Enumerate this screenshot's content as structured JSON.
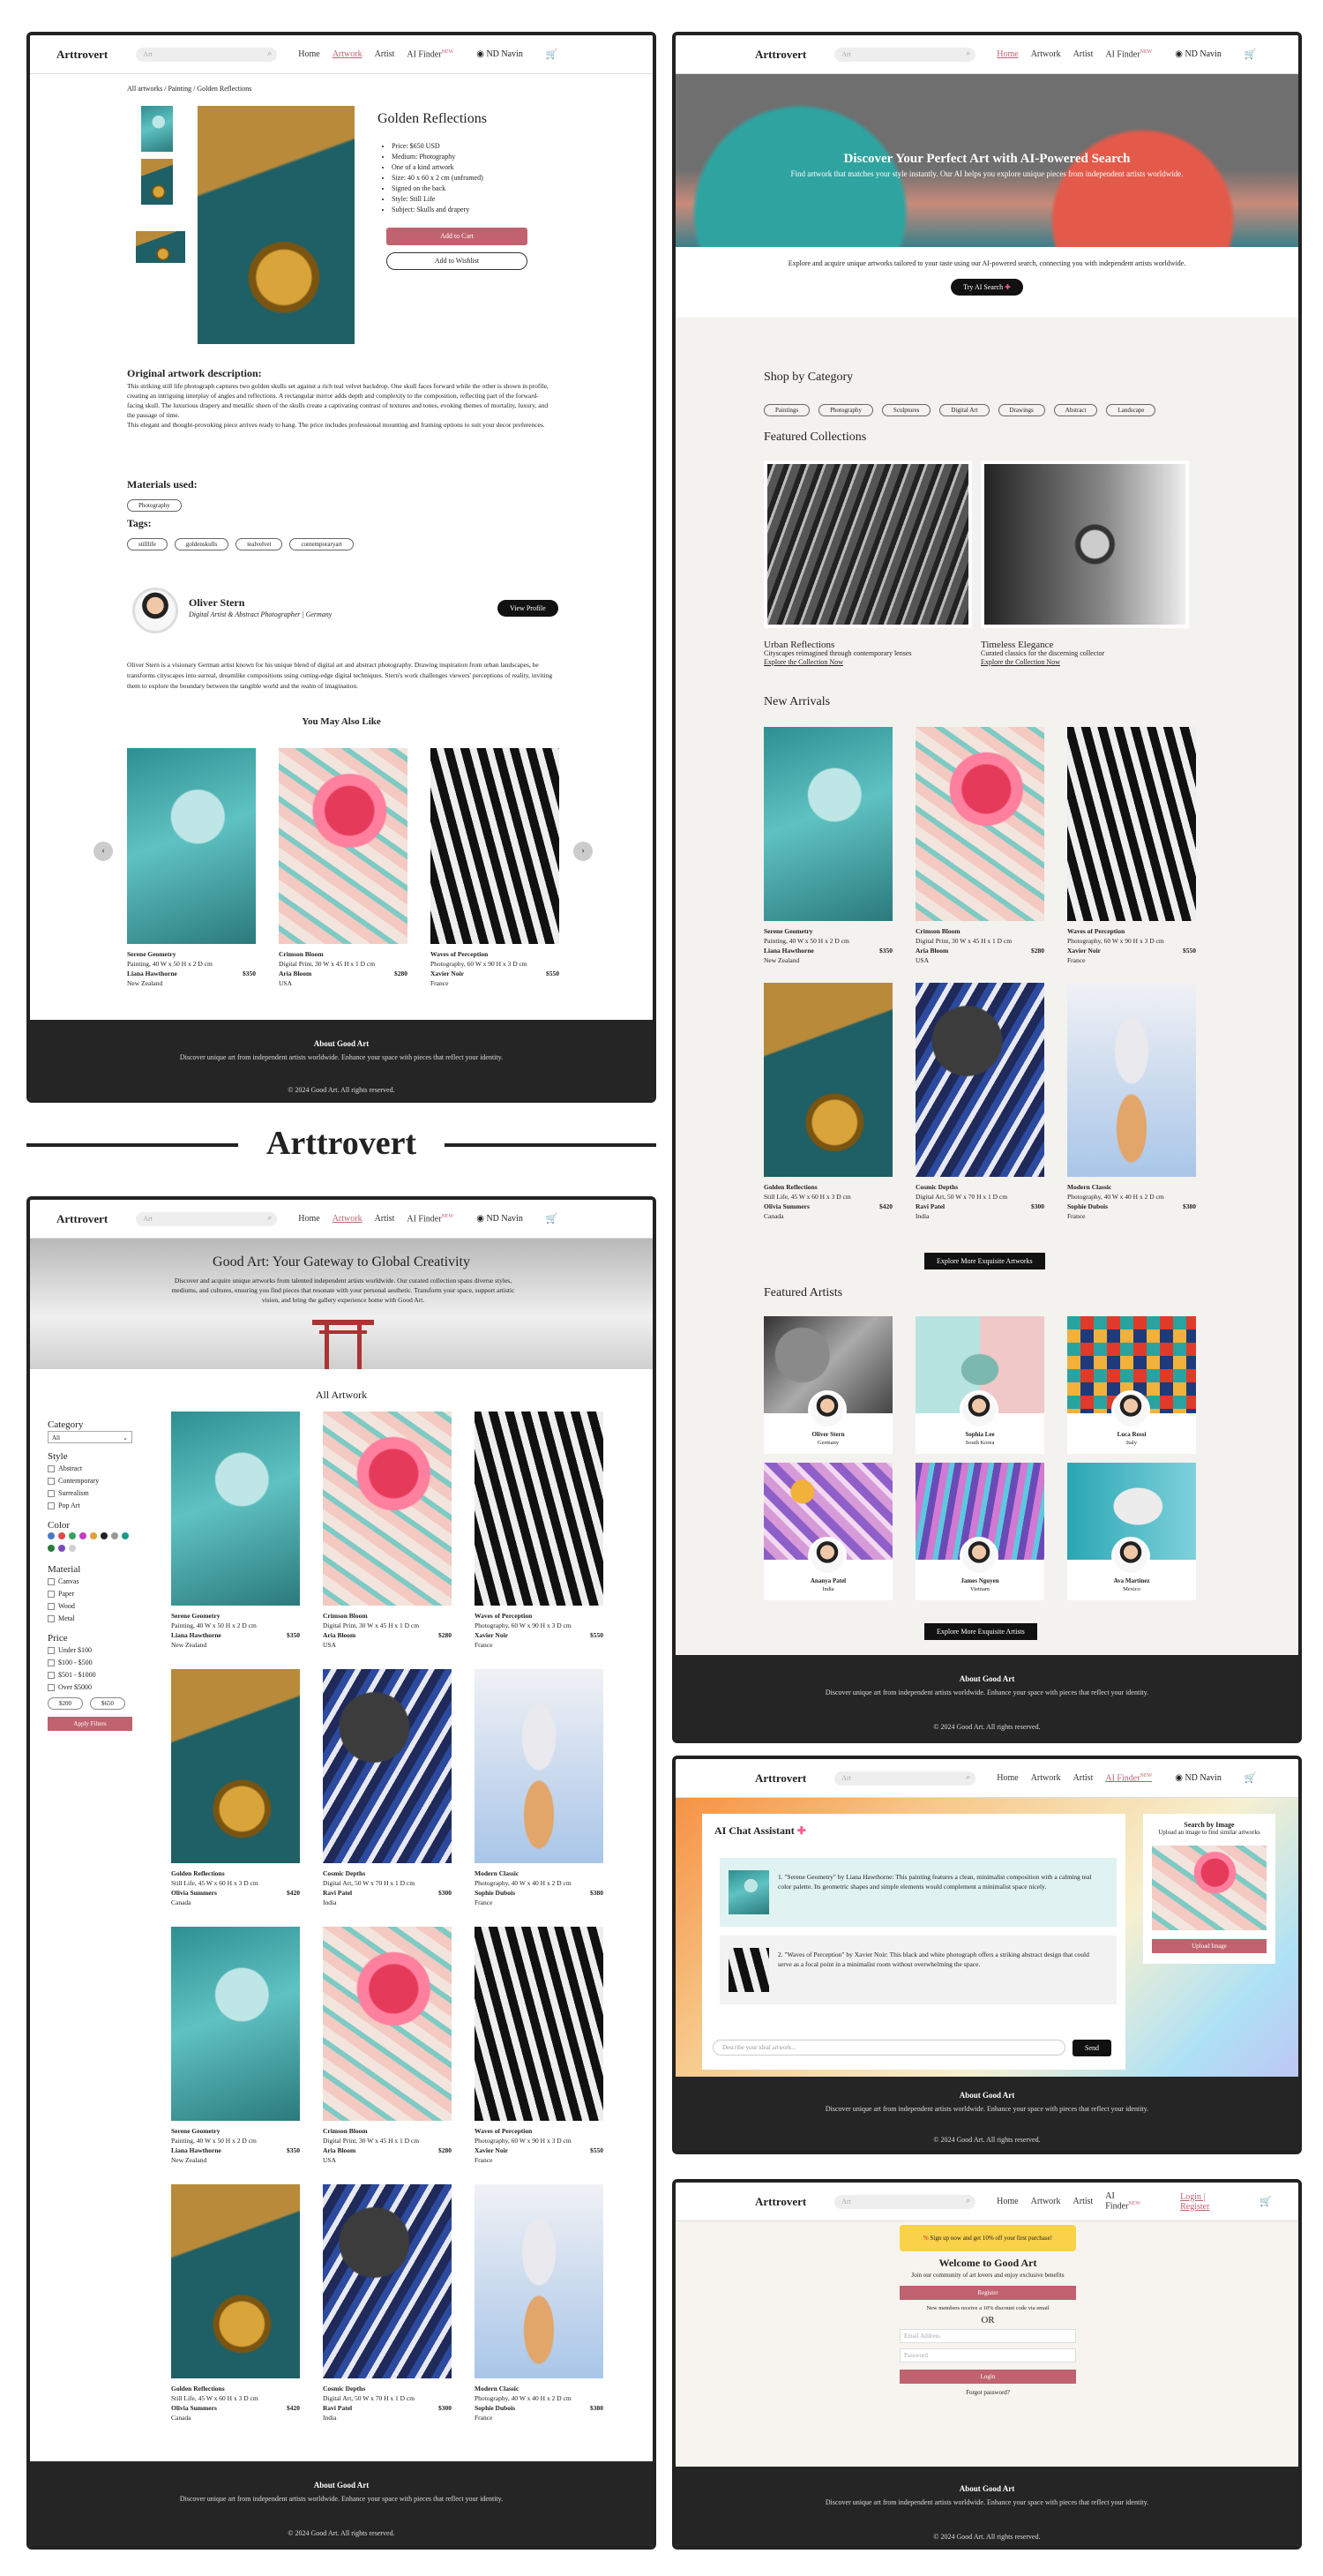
{
  "nav": {
    "logo": "Arttrovert",
    "search": "Art",
    "home": "Home",
    "artwork": "Artwork",
    "artist": "Artist",
    "ai_finder": "AI Finder",
    "new_badge": "NEW",
    "user": "ND Navin",
    "login": "Login | Register",
    "cart_count": "0"
  },
  "brand_banner": "Arttrovert",
  "product": {
    "breadcrumb": "All artworks / Painting / Golden Reflections",
    "title": "Golden Reflections",
    "specs": [
      "Price: $650 USD",
      "Medium: Photography",
      "One of a kind artwork",
      "Size: 40 x 60 x 2 cm (unframed)",
      "Signed on the back",
      "Style: Still Life",
      "Subject: Skulls and drapery"
    ],
    "add_cart": "Add to Cart",
    "add_wishlist": "Add to Wishlist",
    "desc_heading": "Original artwork description:",
    "desc_p1": "This striking still life photograph captures two golden skulls set against a rich teal velvet backdrop. One skull faces forward while the other is shown in profile, creating an intriguing interplay of angles and reflections. A rectangular mirror adds depth and complexity to the composition, reflecting part of the forward-facing skull. The luxurious drapery and metallic sheen of the skulls create a captivating contrast of textures and tones, evoking themes of mortality, luxury, and the passage of time.",
    "desc_p2": "This elegant and thought-provoking piece arrives ready to hang. The price includes professional mounting and framing options to suit your decor preferences.",
    "materials_heading": "Materials used:",
    "materials": [
      "Photography"
    ],
    "tags_heading": "Tags:",
    "tags": [
      "stilllife",
      "goldenskulls",
      "tealvelvet",
      "contemporaryart"
    ],
    "artist_name": "Oliver Stern",
    "artist_role": "Digital Artist & Abstract Photographer | Germany",
    "view_profile": "View Profile",
    "artist_bio": "Oliver Stern is a visionary German artist known for his unique blend of digital art and abstract photography. Drawing inspiration from urban landscapes, he transforms cityscapes into surreal, dreamlike compositions using cutting-edge digital techniques. Stern's work challenges viewers' perceptions of reality, inviting them to explore the boundary between the tangible world and the realm of imagination.",
    "also_like": "You May Also Like"
  },
  "artworks": [
    {
      "title": "Serene Geometry",
      "medium": "Painting, 40 W x 50 H x 2 D cm",
      "artist": "Liana Hawthorne",
      "price": "$350",
      "country": "New Zealand",
      "art": "a-teal"
    },
    {
      "title": "Crimson Bloom",
      "medium": "Digital Print, 30 W x 45 H x 1 D cm",
      "artist": "Aria Bloom",
      "price": "$280",
      "country": "USA",
      "art": "a-flower"
    },
    {
      "title": "Waves of Perception",
      "medium": "Photography, 60 W x 90 H x 3 D cm",
      "artist": "Xavier Noir",
      "price": "$550",
      "country": "France",
      "art": "a-zebra"
    },
    {
      "title": "Golden Reflections",
      "medium": "Still Life, 45 W x 60 H x 3 D cm",
      "artist": "Olivia Summers",
      "price": "$420",
      "country": "Canada",
      "art": "a-gold"
    },
    {
      "title": "Cosmic Depths",
      "medium": "Digital Art, 50 W x 70 H x 1 D cm",
      "artist": "Ravi Patel",
      "price": "$300",
      "country": "India",
      "art": "a-space"
    },
    {
      "title": "Modern Classic",
      "medium": "Photography, 40 W x 40 H x 2 D cm",
      "artist": "Sophie Dubois",
      "price": "$380",
      "country": "France",
      "art": "a-bust"
    }
  ],
  "footer": {
    "heading": "About Good Art",
    "text": "Discover unique art from independent artists worldwide. Enhance your space with pieces that reflect your identity.",
    "copy": "© 2024 Good Art. All rights reserved."
  },
  "home": {
    "hero_title": "Discover Your Perfect Art with AI-Powered Search",
    "hero_sub": "Find artwork that matches your style instantly. Our AI helps you explore unique pieces from independent artists worldwide.",
    "intro": "Explore and acquire unique artworks tailored to your taste using our AI-powered search, connecting you with independent artists worldwide.",
    "try_ai": "Try AI Search",
    "shop_cat": "Shop by Category",
    "categories": [
      "Paintings",
      "Photography",
      "Sculptures",
      "Digital Art",
      "Drawings",
      "Abstract",
      "Landscape"
    ],
    "featured": "Featured Collections",
    "collections": [
      {
        "title": "Urban Reflections",
        "sub": "Cityscapes reimagined through contemporary lenses",
        "link": "Explore the Collection Now"
      },
      {
        "title": "Timeless Elegance",
        "sub": "Curated classics for the discerning collector",
        "link": "Explore the Collection Now"
      }
    ],
    "new_arrivals": "New Arrivals",
    "explore_more": "Explore More Exquisite Artworks",
    "featured_artists": "Featured Artists",
    "artists": [
      {
        "name": "Oliver Stern",
        "country": "Germany"
      },
      {
        "name": "Sophia Lee",
        "country": "South Korea"
      },
      {
        "name": "Luca Rossi",
        "country": "Italy"
      },
      {
        "name": "Ananya Patel",
        "country": "India"
      },
      {
        "name": "James Nguyen",
        "country": "Vietnam"
      },
      {
        "name": "Ava Martinez",
        "country": "Mexico"
      }
    ],
    "explore_artists": "Explore More Exquisite Artists"
  },
  "gallery": {
    "hero_title": "Good Art: Your Gateway to Global Creativity",
    "hero_text": "Discover and acquire unique artworks from talented independent artists worldwide. Our curated collection spans diverse styles, mediums, and cultures, ensuring you find pieces that resonate with your personal aesthetic. Transform your space, support artistic vision, and bring the gallery experience home with Good Art.",
    "all_artwork": "All Artwork",
    "category": "Category",
    "category_value": "All",
    "style": "Style",
    "styles": [
      "Abstract",
      "Contemporary",
      "Surrealism",
      "Pop Art"
    ],
    "color": "Color",
    "colors": [
      "#4a78c9",
      "#e04a4a",
      "#3aa060",
      "#c040c0",
      "#e0a040",
      "#222222",
      "#999999",
      "#1a9a8a",
      "#2a7a3a",
      "#7a4ab8",
      "#d0d0d0"
    ],
    "material": "Material",
    "materials": [
      "Canvas",
      "Paper",
      "Wood",
      "Metal"
    ],
    "price": "Price",
    "prices": [
      "Under $100",
      "$100 - $500",
      "$501 - $1000",
      "Over $5000"
    ],
    "min_price": "$200",
    "max_price": "$650",
    "apply": "Apply Filters"
  },
  "chat": {
    "title": "AI Chat Assistant",
    "msg1": "1. \"Serene Geometry\" by Liana Hawthorne: This painting features a clean, minimalist composition with a calming teal color palette. Its geometric shapes and simple elements would complement a minimalist space nicely.",
    "msg2": "2. \"Waves of Perception\" by Xavier Noir: This black and white photograph offers a striking abstract design that could serve as a focal point in a minimalist room without overwhelming the space.",
    "placeholder": "Describe your ideal artwork...",
    "send": "Send",
    "image_title": "Search by Image",
    "image_sub": "Upload an image to find similar artworks",
    "upload": "Upload Image"
  },
  "login": {
    "promo": "Sign up now and get 10% off your first purchase!",
    "welcome": "Welcome to Good Art",
    "join": "Join our community of art lovers and enjoy exclusive benefits",
    "register": "Register",
    "discount": "New members receive a 10% discount code via email",
    "or": "OR",
    "email": "Email Address",
    "password": "Password",
    "login_btn": "Login",
    "forgot": "Forgot password?"
  }
}
